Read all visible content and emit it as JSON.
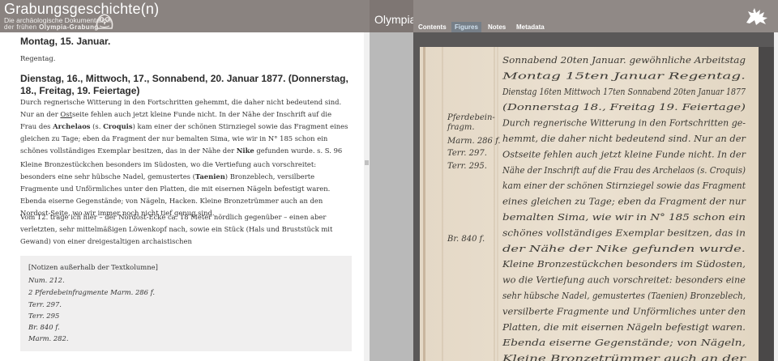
{
  "header": {
    "app_title": "Grabungsgeschichte(n)",
    "subtitle_line1": "Die archäologische Dokumentation",
    "subtitle_line2_prefix": "der frühen ",
    "subtitle_line2_bold": "Olympia-Grabung",
    "site_label": "Olympia",
    "logo_icon": "owl-logo-icon",
    "brand_icon": "griffin-icon"
  },
  "tabs": [
    {
      "label": "Contents",
      "active": false
    },
    {
      "label": "Figures",
      "active": true
    },
    {
      "label": "Notes",
      "active": false
    },
    {
      "label": "Metadata",
      "active": false
    }
  ],
  "text": {
    "entry1_title": "Montag, 15. Januar.",
    "entry1_body": "Regentag.",
    "entry2_title": "Dienstag, 16., Mittwoch, 17., Sonnabend, 20. Januar 1877. (Donnerstag, 18., Freitag, 19. Feiertage)",
    "para1": {
      "t1": "Durch regnerische Witterung in den Fortschritten gehemmt, die daher nicht bedeutend sind. Nur an der ",
      "link_ost": "Ost",
      "t2": "seite fehlen auch jetzt kleine Funde nicht. In der Nähe der Inschrift auf die Frau des ",
      "b_archelaos": "Archelaos",
      "t3": " (s. ",
      "b_croquis": "Croquis",
      "t4": ") kam einer der schönen Stirnziegel sowie das Fragment eines gleichen zu Tage; eben da Fragment der nur bemalten Sima, wie wir in N° 185 schon ein schönes vollständiges Exemplar besitzen, das in der Nähe der ",
      "b_nike": "Nike",
      "t5": " gefunden wurde. s. S. 96"
    },
    "para2": {
      "t1": "Kleine Bronzestückchen besonders im Südosten, wo die Vertiefung auch vorschreitet: besonders eine sehr hübsche Nadel, gemustertes (",
      "b_taenien": "Taenien",
      "t2": ") Bronzeblech, versilberte Fragmente und Unförmliches unter den Platten, die mit eisernen Nägeln befestigt waren. Ebenda eiserne Gegenstände; von Nägeln, Hacken. Kleine Bronzetrümmer auch an den Nordost-Seite, wo wir immer noch nicht tief genug sind."
    },
    "para3": "Vom 12. trage ich hier – der Nordost-Ecke ca. 18 Meter nördlich gegenüber – einen aber verletzten, sehr mittelmäßigen Löwenkopf nach, sowie ein Stück (Hals und Bruststück mit Gewand) von einer dreigestaltigen archaistischen"
  },
  "notes": {
    "heading": "[Notizen außerhalb der Textkolumne]",
    "items": [
      "Num. 212.",
      "2 Pferdebeinfragmente Marm. 286 f.",
      "Terr. 297.",
      "Terr. 295",
      "Br. 840 f.",
      "Marm. 282."
    ]
  },
  "manuscript": {
    "lines": [
      "Sonnabend 20ten Januar.   gewöhnliche Arbeitstag",
      "Montag 15ten Januar   Regentag.",
      "Dienstag 16ten Mittwoch 17ten Sonnabend 20ten Januar 1877",
      "(Donnerstag 18., Freitag 19. Feiertage)",
      "Durch regnerische Witterung in den Fortschritten ge-",
      "hemmt, die daher nicht bedeutend sind. Nur an der",
      "Ostseite fehlen auch jetzt kleine Funde nicht. In der",
      "Nähe der Inschrift auf die Frau des Archelaos (s. Croquis)",
      "kam einer der schönen Stirnziegel sowie das Fragment",
      "eines gleichen zu Tage; eben da Fragment der nur",
      "bemalten Sima, wie wir in N° 185 schon ein",
      "schönes vollständiges Exemplar besitzen, das in",
      "der Nähe der Nike gefunden wurde.",
      "Kleine Bronzestückchen besonders im Südosten,",
      "wo die Vertiefung auch vorschreitet: besonders eine",
      "sehr hübsche Nadel, gemustertes (Taenien) Bronzeblech,",
      "versilberte Fragmente und Unförmliches unter den",
      "Platten, die mit eisernen Nägeln befestigt waren.",
      "Ebenda eiserne Gegenstände; von Nägeln,",
      "Kleine Bronzetrümmer auch an der"
    ],
    "margin_notes": [
      "Pferdebein-",
      "fragm.",
      "Marm. 286 f.",
      "Terr. 297.",
      "Terr. 295.",
      "Br. 840 f."
    ]
  }
}
